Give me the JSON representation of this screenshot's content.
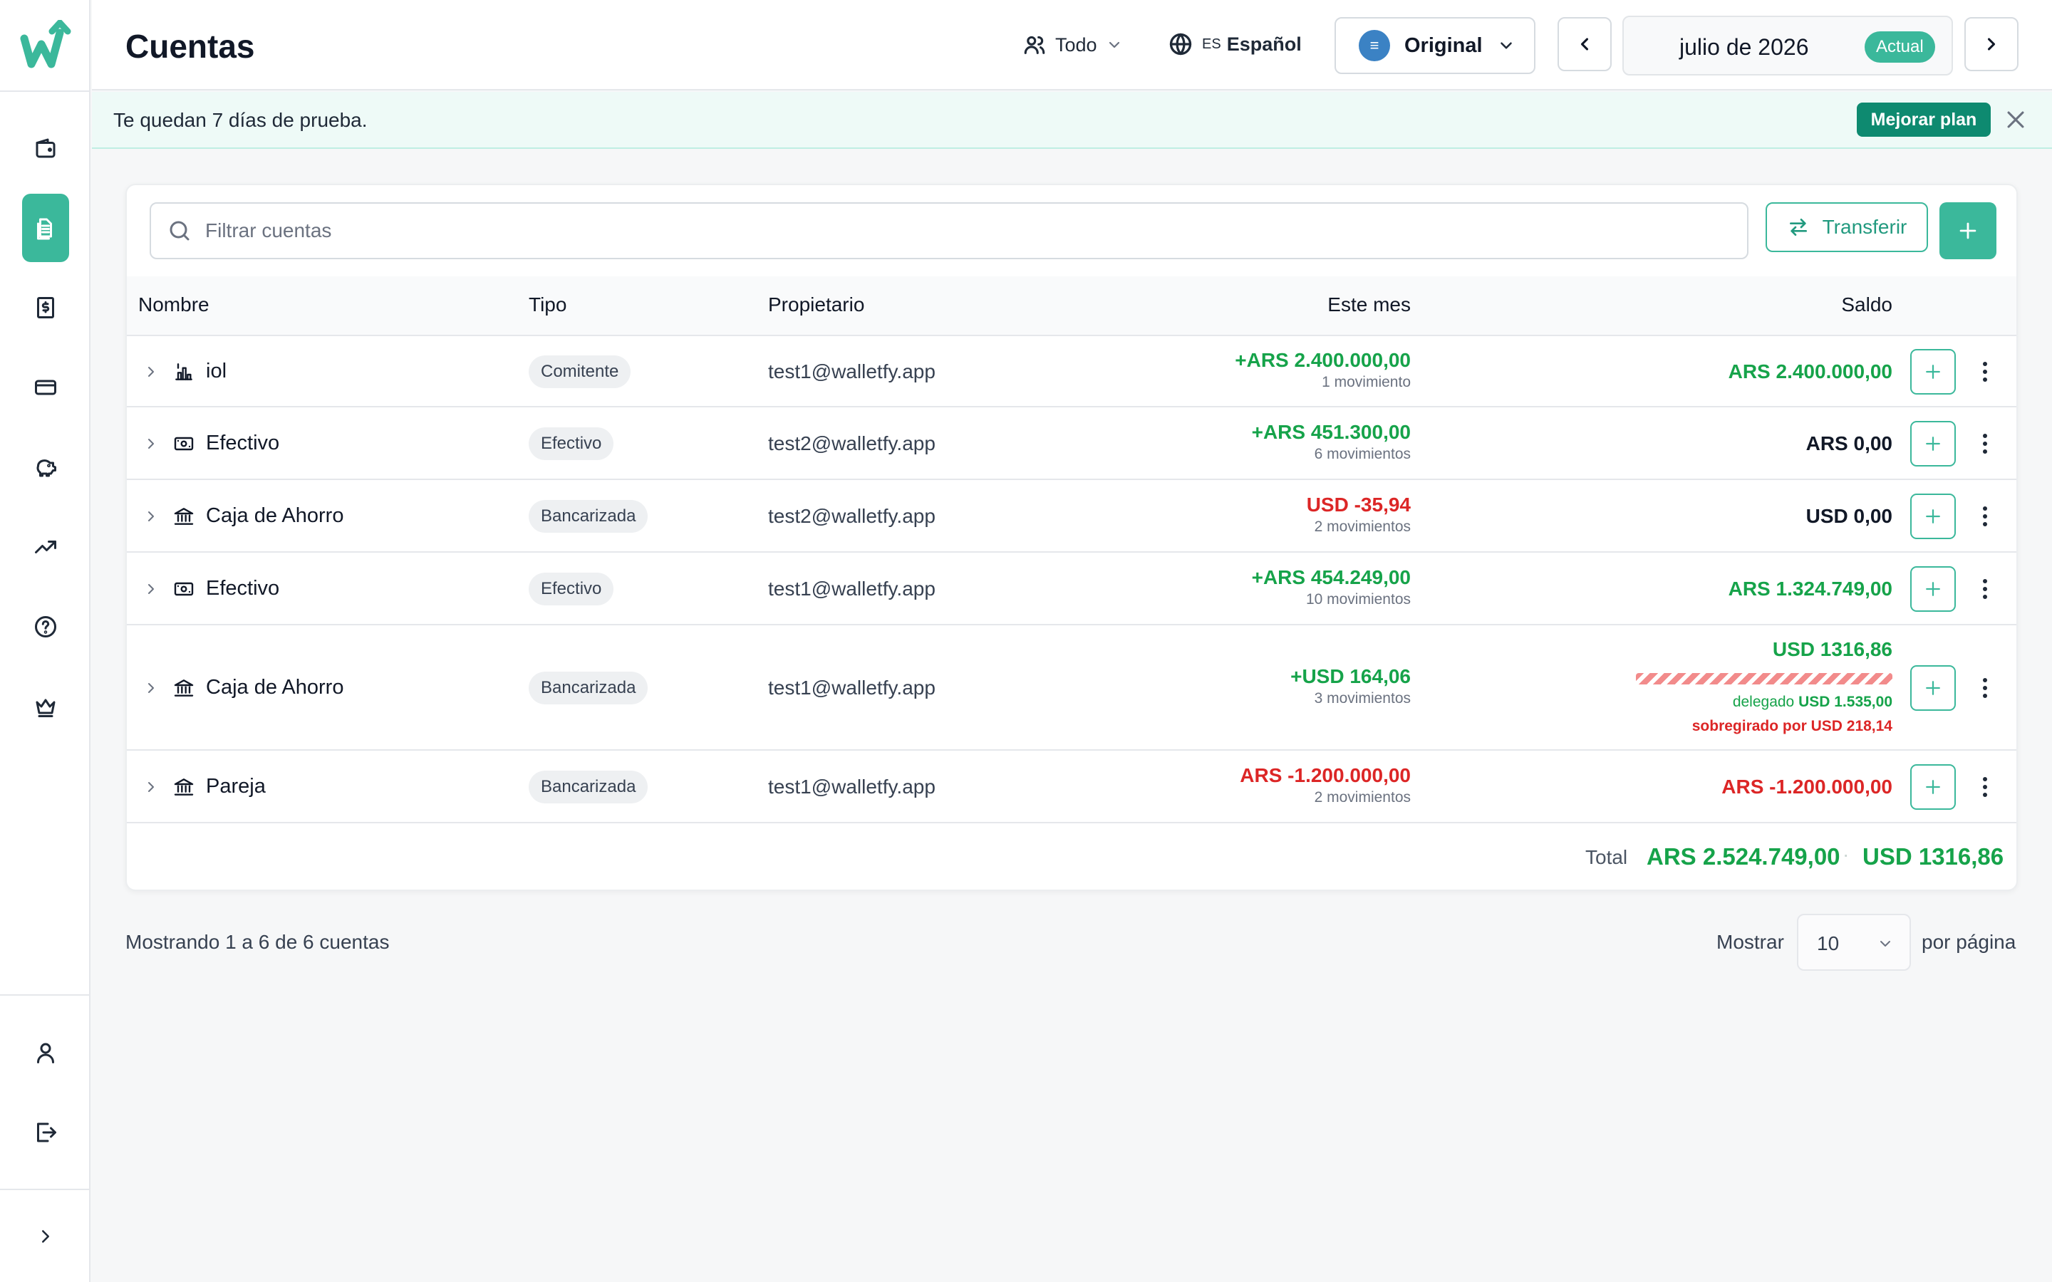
{
  "app": {
    "page_title": "Cuentas"
  },
  "colors": {
    "accent": "#3bb89b",
    "accent_dark": "#0e8a70",
    "positive": "#16a34a",
    "negative": "#dc2626",
    "banner_bg": "#eefaf7"
  },
  "sidebar": {
    "logo_icon": "walletfy-logo-icon",
    "items": [
      {
        "icon": "wallet-icon",
        "active": false
      },
      {
        "icon": "bank-accounts-icon",
        "active": true
      },
      {
        "icon": "dollar-receipt-icon",
        "active": false
      },
      {
        "icon": "credit-card-icon",
        "active": false
      },
      {
        "icon": "piggy-bank-icon",
        "active": false
      },
      {
        "icon": "trending-up-icon",
        "active": false
      },
      {
        "icon": "help-circle-icon",
        "active": false
      },
      {
        "icon": "crown-icon",
        "active": false
      }
    ],
    "bottom_items": [
      {
        "icon": "user-icon"
      },
      {
        "icon": "logout-icon"
      },
      {
        "icon": "chevron-right-icon"
      }
    ]
  },
  "header": {
    "owner_filter": "Todo",
    "language_code": "ES",
    "language": "Español",
    "currency_mode_icon_text": "≡",
    "currency_mode": "Original",
    "period": "julio de 2026",
    "period_badge": "Actual"
  },
  "banner": {
    "text": "Te quedan 7 días de prueba.",
    "upgrade_label": "Mejorar plan"
  },
  "toolbar": {
    "search_placeholder": "Filtrar cuentas",
    "transfer_label": "Transferir"
  },
  "table": {
    "columns": {
      "name": "Nombre",
      "type": "Tipo",
      "owner": "Propietario",
      "month": "Este mes",
      "balance": "Saldo"
    },
    "rows": [
      {
        "icon": "chart-icon",
        "name": "iol",
        "type": "Comitente",
        "owner": "test1@walletfy.app",
        "month_amount": "+ARS 2.400.000,00",
        "month_sign": "positive",
        "month_count": "1 movimiento",
        "balance": "ARS 2.400.000,00",
        "balance_sign": "positive"
      },
      {
        "icon": "cash-icon",
        "name": "Efectivo",
        "type": "Efectivo",
        "owner": "test2@walletfy.app",
        "month_amount": "+ARS 451.300,00",
        "month_sign": "positive",
        "month_count": "6 movimientos",
        "balance": "ARS 0,00",
        "balance_sign": "neutral"
      },
      {
        "icon": "bank-icon",
        "name": "Caja de Ahorro",
        "type": "Bancarizada",
        "owner": "test2@walletfy.app",
        "month_amount": "USD -35,94",
        "month_sign": "negative",
        "month_count": "2 movimientos",
        "balance": "USD 0,00",
        "balance_sign": "neutral"
      },
      {
        "icon": "cash-icon",
        "name": "Efectivo",
        "type": "Efectivo",
        "owner": "test1@walletfy.app",
        "month_amount": "+ARS 454.249,00",
        "month_sign": "positive",
        "month_count": "10 movimientos",
        "balance": "ARS 1.324.749,00",
        "balance_sign": "positive"
      },
      {
        "icon": "bank-icon",
        "name": "Caja de Ahorro",
        "type": "Bancarizada",
        "owner": "test1@walletfy.app",
        "month_amount": "+USD 164,06",
        "month_sign": "positive",
        "month_count": "3 movimientos",
        "balance": "USD 1316,86",
        "balance_sign": "positive",
        "delegated_label": "delegado",
        "delegated_amount": "USD 1.535,00",
        "overdraft_text": "sobregirado por USD 218,14",
        "delegated_fill": 1.0
      },
      {
        "icon": "bank-icon",
        "name": "Pareja",
        "type": "Bancarizada",
        "owner": "test1@walletfy.app",
        "month_amount": "ARS -1.200.000,00",
        "month_sign": "negative",
        "month_count": "2 movimientos",
        "balance": "ARS -1.200.000,00",
        "balance_sign": "negative"
      }
    ],
    "total_label": "Total",
    "total_ars": "ARS 2.524.749,00",
    "total_separator": "·",
    "total_usd": "USD 1316,86"
  },
  "footer": {
    "showing": "Mostrando 1 a 6 de 6 cuentas",
    "show_label": "Mostrar",
    "page_size": "10",
    "per_page_label": "por página"
  }
}
